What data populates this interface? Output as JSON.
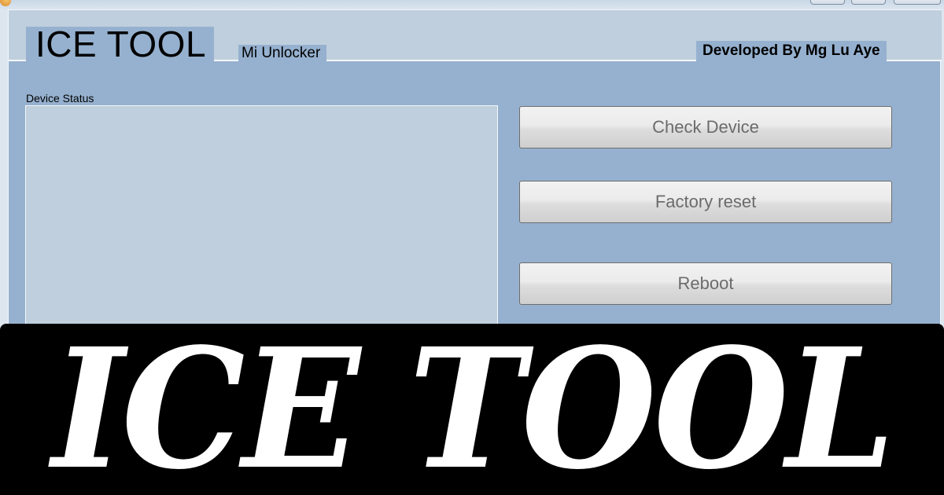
{
  "app": {
    "title": "ICE TOOL",
    "subtitle": "Mi Unlocker",
    "credit": "Developed By Mg Lu Aye"
  },
  "status": {
    "label": "Device Status",
    "content": ""
  },
  "actions": {
    "check_device": "Check Device",
    "factory_reset": "Factory reset",
    "reboot": "Reboot"
  },
  "banner": {
    "text": "ICE TOOL"
  },
  "icons": {
    "app": "app-icon",
    "minimize": "minimize-icon",
    "maximize": "maximize-icon",
    "close": "close-icon"
  },
  "colors": {
    "frame_background": "#96b1cf",
    "header_band": "#bfcfdd",
    "status_box": "#bfcfdd",
    "button_text": "#6b6b6b",
    "banner_background": "#000000",
    "banner_text": "#ffffff"
  }
}
